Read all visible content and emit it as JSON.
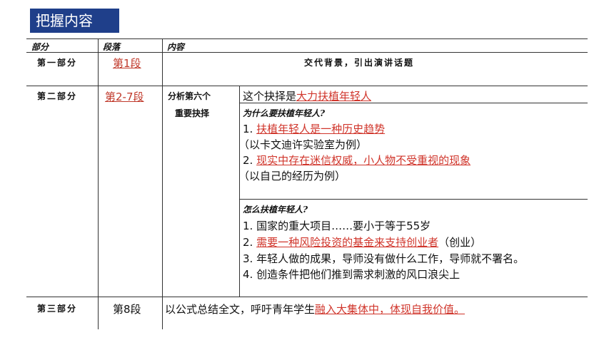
{
  "slide_title": "把握内容",
  "header": {
    "col1": "部分",
    "col2": "段落",
    "col3": "内容"
  },
  "row1": {
    "part": "第一部分",
    "para": "第1段",
    "content": "交代背景，引出演讲话题"
  },
  "row2": {
    "part": "第二部分",
    "para": "第2-7段",
    "sub_label_1": "分析第六个",
    "sub_label_2": "重要抉择",
    "choice_prefix": "这个抉择是",
    "choice_red": "大力扶植年轻人",
    "q1": "为什么要扶植年轻人?",
    "q1_l1_num": "1. ",
    "q1_l1_red": "扶植年轻人是一种历史趋势",
    "q1_l2": "（以卡文迪许实验室为例）",
    "q1_l3_num": "2. ",
    "q1_l3_red": "现实中存在迷信权威，小人物不受重视的现象",
    "q1_l4": "（以自己的经历为例）",
    "q2": "怎么扶植年轻人?",
    "q2_l1": "1. 国家的重大项目……要小于等于55岁",
    "q2_l2_num": "2. ",
    "q2_l2_red": "需要一种风险投资的基金来支持创业者",
    "q2_l2_tail": "（创业）",
    "q2_l3": "3. 年轻人做的成果，导师没有做什么工作，导师就不署名。",
    "q2_l4": "4. 创造条件把他们推到需求刺激的风口浪尖上"
  },
  "row3": {
    "part": "第三部分",
    "para": "第8段",
    "content_prefix": "以公式总结全文，呼吁青年学生",
    "content_red": "融入大集体中，体现自我价值。"
  }
}
